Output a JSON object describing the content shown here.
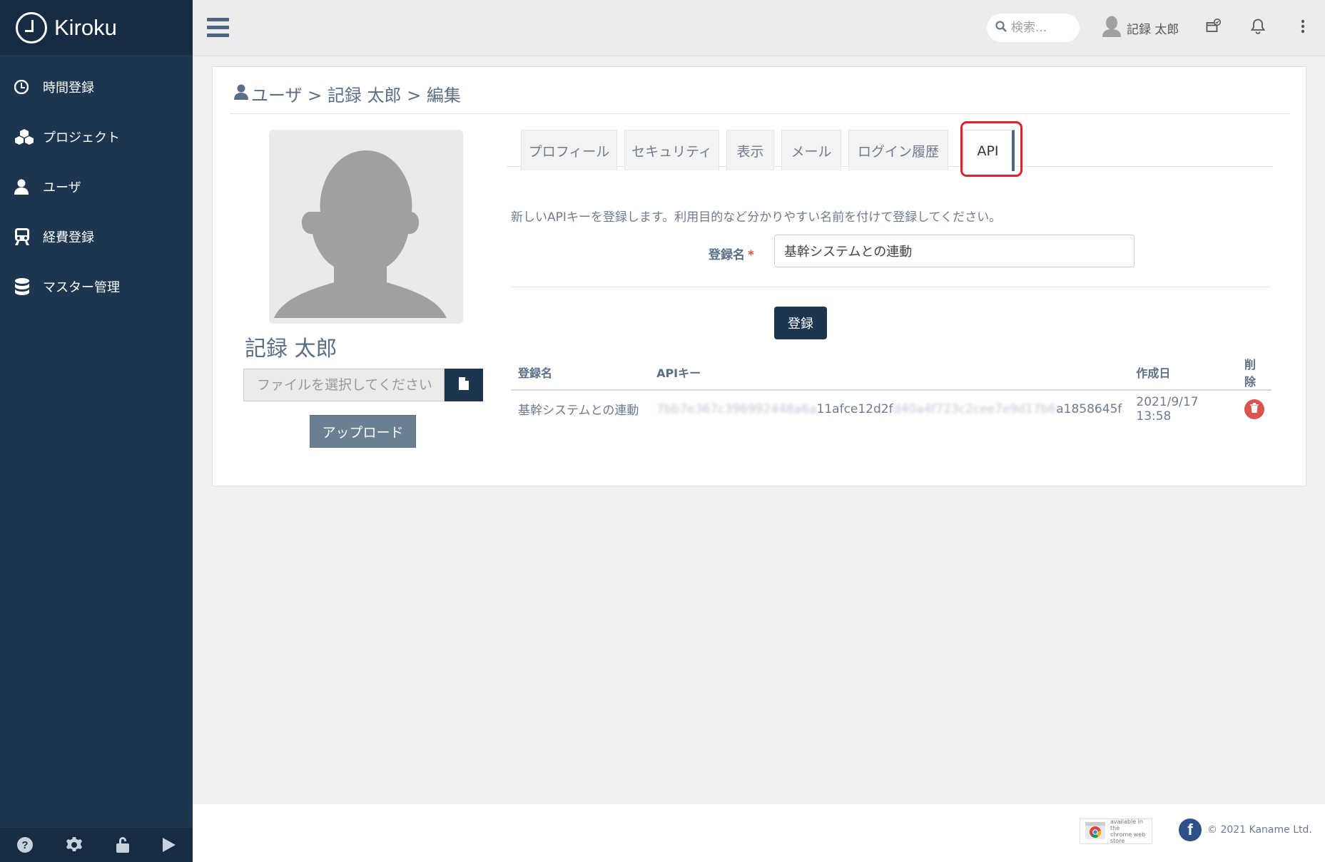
{
  "app": {
    "name": "Kiroku"
  },
  "sidebar": {
    "items": [
      {
        "label": "時間登録",
        "icon": "clock-icon"
      },
      {
        "label": "プロジェクト",
        "icon": "cubes-icon"
      },
      {
        "label": "ユーザ",
        "icon": "user-icon"
      },
      {
        "label": "経費登録",
        "icon": "train-icon"
      },
      {
        "label": "マスター管理",
        "icon": "database-icon"
      }
    ],
    "footer_icons": [
      "help-icon",
      "gear-icon",
      "unlock-icon",
      "play-icon"
    ]
  },
  "topbar": {
    "search_placeholder": "検索...",
    "user_name": "記録 太郎"
  },
  "breadcrumb": {
    "text": "ユーザ > 記録 太郎 > 編集"
  },
  "profile": {
    "name": "記録 太郎",
    "file_placeholder": "ファイルを選択してください",
    "upload_label": "アップロード"
  },
  "tabs": [
    {
      "label": "プロフィール",
      "active": false
    },
    {
      "label": "セキュリティ",
      "active": false
    },
    {
      "label": "表示",
      "active": false
    },
    {
      "label": "メール",
      "active": false
    },
    {
      "label": "ログイン履歴",
      "active": false
    },
    {
      "label": "API",
      "active": true
    }
  ],
  "api_form": {
    "description": "新しいAPIキーを登録します。利用目的など分かりやすい名前を付けて登録してください。",
    "name_label": "登録名",
    "required_mark": "*",
    "name_value": "基幹システムとの連動",
    "register_label": "登録"
  },
  "api_table": {
    "headers": {
      "name": "登録名",
      "key": "APIキー",
      "created": "作成日",
      "delete": "削除"
    },
    "rows": [
      {
        "name": "基幹システムとの連動",
        "key_part1": "7bb7e367c396992448a6a",
        "key_part2": "11afce12d2f",
        "key_part3": "d40a4f723c2cee7e9d17b6",
        "key_part4": "a1858645f",
        "created": "2021/9/17 13:58"
      }
    ]
  },
  "footer": {
    "chrome_store_line1": "available in the",
    "chrome_store_line2": "chrome web store",
    "facebook_glyph": "f",
    "copyright": "© 2021 Kaname Ltd."
  },
  "colors": {
    "sidebar": "#1e3550",
    "brand_bar": "#172b42",
    "primary_button": "#1e3550",
    "danger": "#d9534f",
    "highlight": "#e0202d"
  }
}
